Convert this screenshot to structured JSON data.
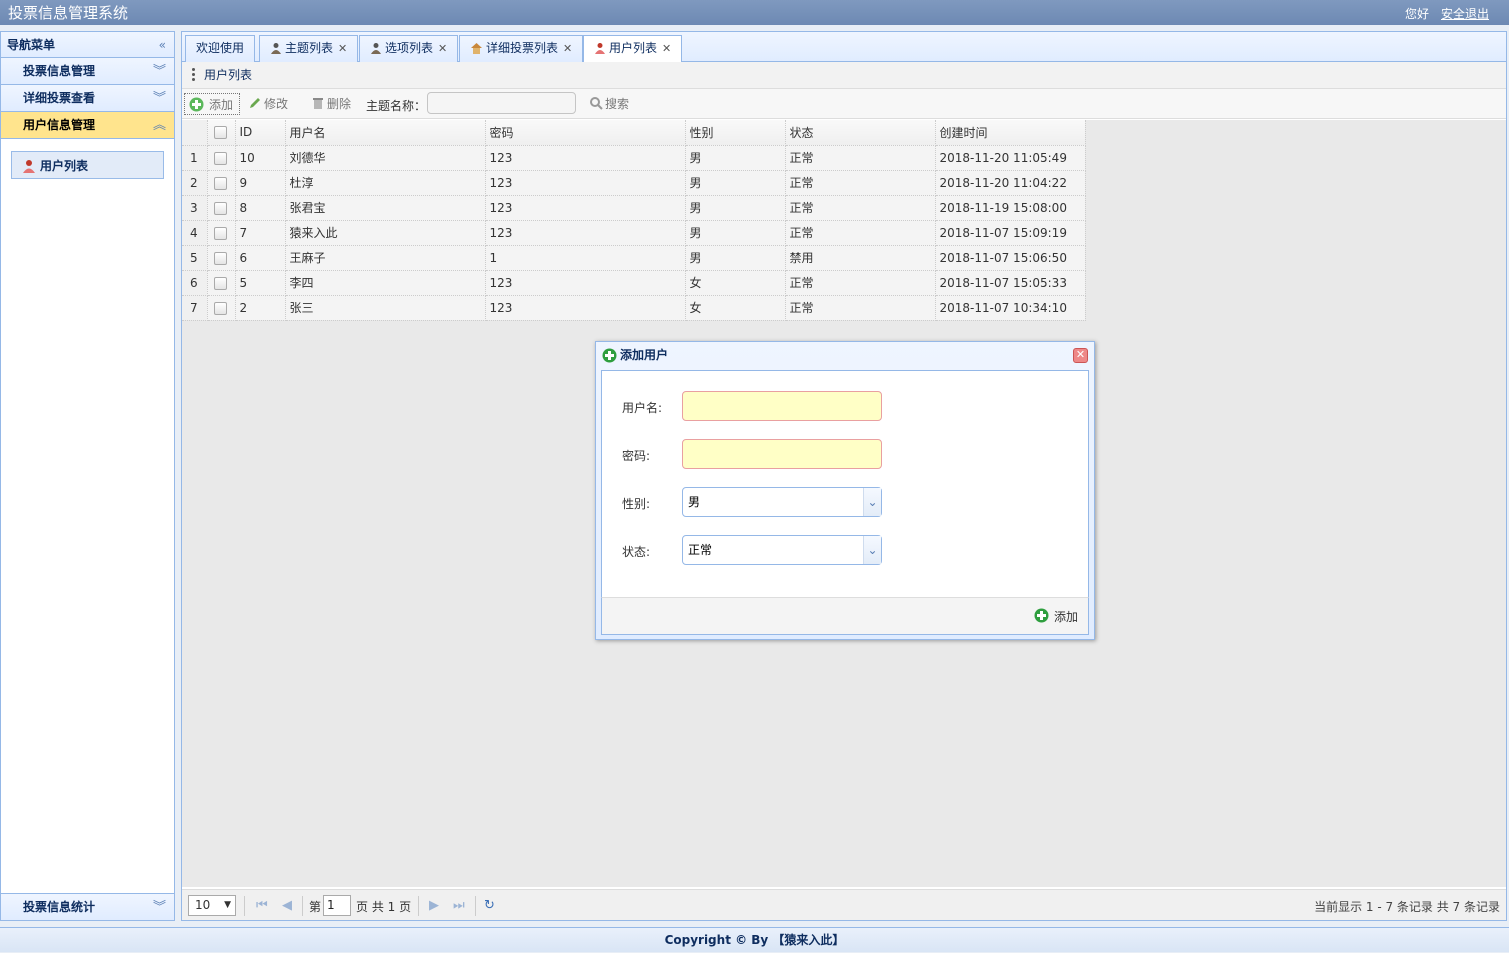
{
  "header": {
    "title": "投票信息管理系统",
    "greeting": "您好",
    "logout": "安全退出"
  },
  "nav": {
    "title": "导航菜单",
    "sections": [
      {
        "label": "投票信息管理"
      },
      {
        "label": "详细投票查看"
      },
      {
        "label": "用户信息管理"
      }
    ],
    "active_item": "用户列表",
    "bottom_section": "投票信息统计"
  },
  "tabs": [
    {
      "label": "欢迎使用"
    },
    {
      "label": "主题列表"
    },
    {
      "label": "选项列表"
    },
    {
      "label": "详细投票列表"
    },
    {
      "label": "用户列表"
    }
  ],
  "panel": {
    "title": "用户列表"
  },
  "toolbar": {
    "add": "添加",
    "edit": "修改",
    "delete": "删除",
    "search_label": "主题名称：",
    "search_button": "搜索"
  },
  "table": {
    "headers": {
      "id": "ID",
      "username": "用户名",
      "password": "密码",
      "gender": "性别",
      "status": "状态",
      "created": "创建时间"
    },
    "rows": [
      {
        "n": "1",
        "id": "10",
        "username": "刘德华",
        "password": "123",
        "gender": "男",
        "status": "正常",
        "created": "2018-11-20 11:05:49"
      },
      {
        "n": "2",
        "id": "9",
        "username": "杜淳",
        "password": "123",
        "gender": "男",
        "status": "正常",
        "created": "2018-11-20 11:04:22"
      },
      {
        "n": "3",
        "id": "8",
        "username": "张君宝",
        "password": "123",
        "gender": "男",
        "status": "正常",
        "created": "2018-11-19 15:08:00"
      },
      {
        "n": "4",
        "id": "7",
        "username": "猿来入此",
        "password": "123",
        "gender": "男",
        "status": "正常",
        "created": "2018-11-07 15:09:19"
      },
      {
        "n": "5",
        "id": "6",
        "username": "王麻子",
        "password": "1",
        "gender": "男",
        "status": "禁用",
        "created": "2018-11-07 15:06:50"
      },
      {
        "n": "6",
        "id": "5",
        "username": "李四",
        "password": "123",
        "gender": "女",
        "status": "正常",
        "created": "2018-11-07 15:05:33"
      },
      {
        "n": "7",
        "id": "2",
        "username": "张三",
        "password": "123",
        "gender": "女",
        "status": "正常",
        "created": "2018-11-07 10:34:10"
      }
    ]
  },
  "pager": {
    "page_size": "10",
    "page_prefix": "第",
    "page_value": "1",
    "page_suffix": "页 共 1 页",
    "info": "当前显示 1 - 7 条记录 共 7 条记录"
  },
  "dialog": {
    "title": "添加用户",
    "username_label": "用户名:",
    "password_label": "密码:",
    "gender_label": "性别:",
    "gender_value": "男",
    "status_label": "状态:",
    "status_value": "正常",
    "submit": "添加"
  },
  "footer": "Copyright © By 【猿来入此】"
}
